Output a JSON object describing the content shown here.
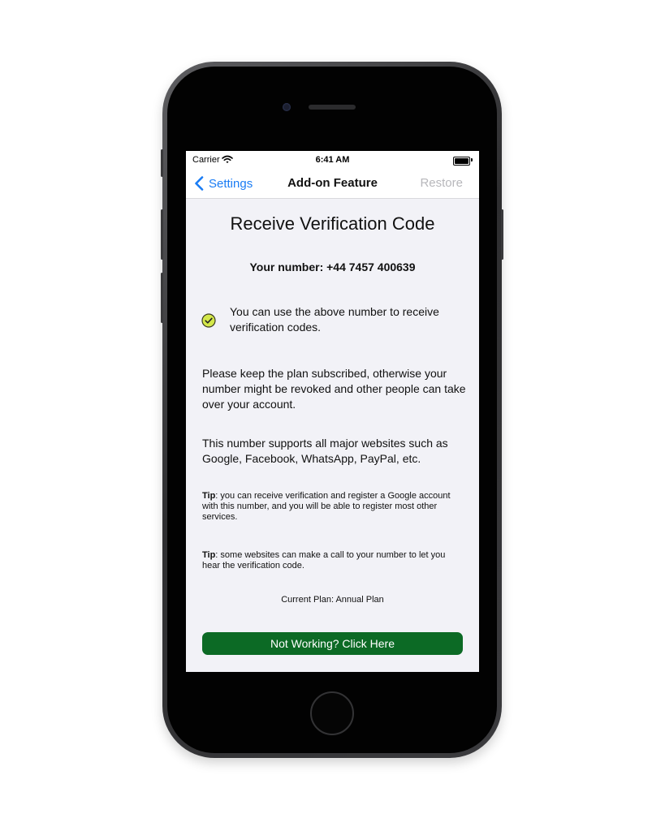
{
  "status_bar": {
    "carrier": "Carrier",
    "time": "6:41 AM"
  },
  "nav": {
    "back_label": "Settings",
    "title": "Add-on Feature",
    "restore_label": "Restore"
  },
  "content": {
    "title": "Receive Verification Code",
    "your_number": "Your number: +44 7457 400639",
    "check_text": "You can use the above number to receive verification codes.",
    "paragraph1": "Please keep the plan subscribed, otherwise your number might be revoked and other people can take over your account.",
    "paragraph2": "This number supports all major websites such as Google, Facebook, WhatsApp, PayPal, etc.",
    "tip_label": "Tip",
    "tip1_text": ": you can receive verification and register a Google account with this number, and you will be able to register most other services.",
    "tip2_text": ": some websites can make a call to your number to let you hear the verification code.",
    "current_plan": "Current Plan: Annual Plan",
    "action_button": "Not Working? Click Here"
  },
  "colors": {
    "accent_blue": "#1a7cf4",
    "button_green": "#0c6a25",
    "check_fill": "#d4e84a",
    "disabled_gray": "#b7b7bb"
  },
  "icons": [
    "wifi-icon",
    "battery-icon",
    "chevron-left-icon",
    "check-circle-icon"
  ]
}
